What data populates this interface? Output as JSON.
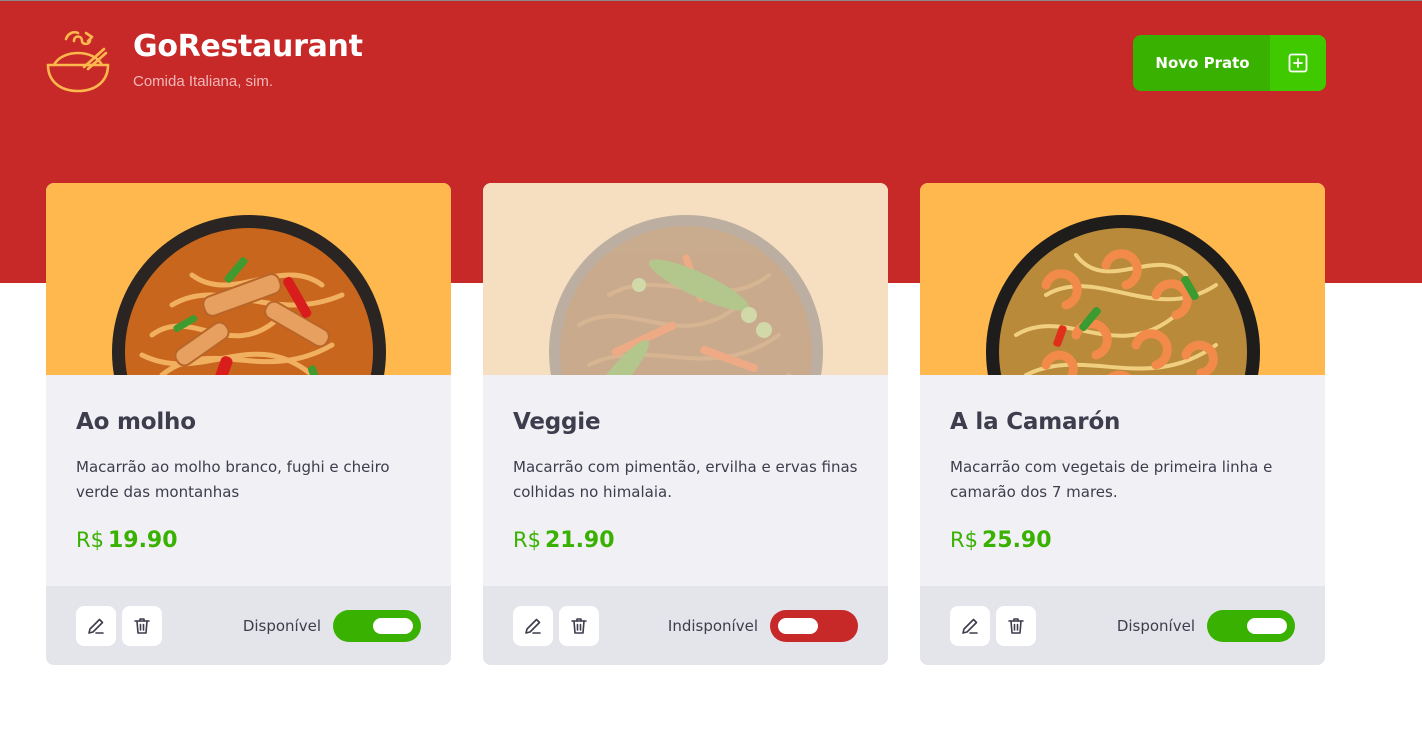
{
  "header": {
    "title": "GoRestaurant",
    "subtitle": "Comida Italiana, sim.",
    "new_button_label": "Novo Prato",
    "logo_icon": "bowl-icon",
    "new_button_icon": "plus-square-icon"
  },
  "colors": {
    "brand_red": "#c72828",
    "accent_green": "#39b100",
    "card_media_orange": "#ffb84d"
  },
  "foods": [
    {
      "name": "Ao molho",
      "description": "Macarrão ao molho branco, fughi e cheiro verde das montanhas",
      "currency": "R$",
      "price": "19.90",
      "available": true,
      "availability_label": "Disponível",
      "edit_icon": "pencil-icon",
      "delete_icon": "trash-icon"
    },
    {
      "name": "Veggie",
      "description": "Macarrão com pimentão, ervilha e ervas finas colhidas no himalaia.",
      "currency": "R$",
      "price": "21.90",
      "available": false,
      "availability_label": "Indisponível",
      "edit_icon": "pencil-icon",
      "delete_icon": "trash-icon"
    },
    {
      "name": "A la Camarón",
      "description": "Macarrão com vegetais de primeira linha e camarão dos 7 mares.",
      "currency": "R$",
      "price": "25.90",
      "available": true,
      "availability_label": "Disponível",
      "edit_icon": "pencil-icon",
      "delete_icon": "trash-icon"
    }
  ]
}
